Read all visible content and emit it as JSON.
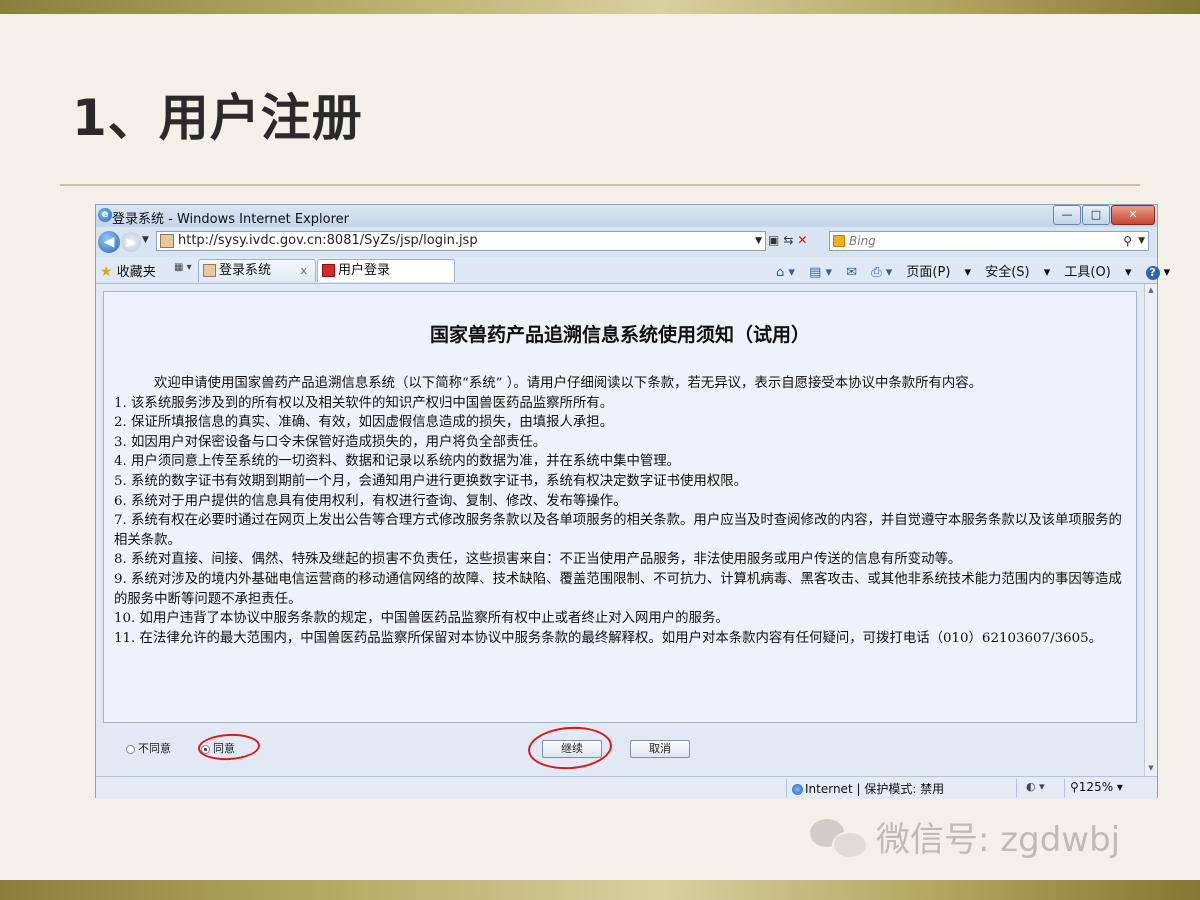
{
  "slide": {
    "title": "1、用户注册",
    "watermark": "微信号: zgdwbj"
  },
  "window": {
    "title": "登录系统 - Windows Internet Explorer",
    "minimize": "—",
    "maximize": "□",
    "close": "✕"
  },
  "address": {
    "url": "http://sysy.ivdc.gov.cn:8081/SyZs/jsp/login.jsp",
    "search_placeholder": "Bing"
  },
  "tabs": {
    "favorites": "收藏夹",
    "items": [
      {
        "label": "登录系统",
        "close": "x"
      },
      {
        "label": "用户登录"
      }
    ]
  },
  "command_bar": {
    "page": "页面(P)",
    "safety": "安全(S)",
    "tools": "工具(O)"
  },
  "notice": {
    "title": "国家兽药产品追溯信息系统使用须知（试用）",
    "intro": "欢迎申请使用国家兽药产品追溯信息系统（以下简称“系统” ）。请用户仔细阅读以下条款，若无异议，表示自愿接受本协议中条款所有内容。",
    "items": [
      "1. 该系统服务涉及到的所有权以及相关软件的知识产权归中国兽医药品监察所所有。",
      "2. 保证所填报信息的真实、准确、有效，如因虚假信息造成的损失，由填报人承担。",
      "3. 如因用户对保密设备与口令未保管好造成损失的，用户将负全部责任。",
      "4. 用户须同意上传至系统的一切资料、数据和记录以系统内的数据为准，并在系统中集中管理。",
      "5. 系统的数字证书有效期到期前一个月，会通知用户进行更换数字证书，系统有权决定数字证书使用权限。",
      "6. 系统对于用户提供的信息具有使用权利，有权进行查询、复制、修改、发布等操作。",
      "7. 系统有权在必要时通过在网页上发出公告等合理方式修改服务条款以及各单项服务的相关条款。用户应当及时查阅修改的内容，并自觉遵守本服务条款以及该单项服务的相关条款。",
      "8. 系统对直接、间接、偶然、特殊及继起的损害不负责任，这些损害来自：不正当使用产品服务，非法使用服务或用户传送的信息有所变动等。",
      "9. 系统对涉及的境内外基础电信运营商的移动通信网络的故障、技术缺陷、覆盖范围限制、不可抗力、计算机病毒、黑客攻击、或其他非系统技术能力范围内的事因等造成的服务中断等问题不承担责任。",
      "10. 如用户违背了本协议中服务条款的规定，中国兽医药品监察所有权中止或者终止对入网用户的服务。",
      "11. 在法律允许的最大范围内，中国兽医药品监察所保留对本协议中服务条款的最终解释权。如用户对本条款内容有任何疑问，可拨打电话（010）62103607/3605。"
    ]
  },
  "form": {
    "disagree": "不同意",
    "agree": "同意",
    "agree_selected": true,
    "continue": "继续",
    "cancel": "取消"
  },
  "status": {
    "zone": "Internet | 保护模式: 禁用",
    "zoom": "125%"
  },
  "colors": {
    "annotation_red": "#d61a1a",
    "gold": "#b9ad6a"
  }
}
